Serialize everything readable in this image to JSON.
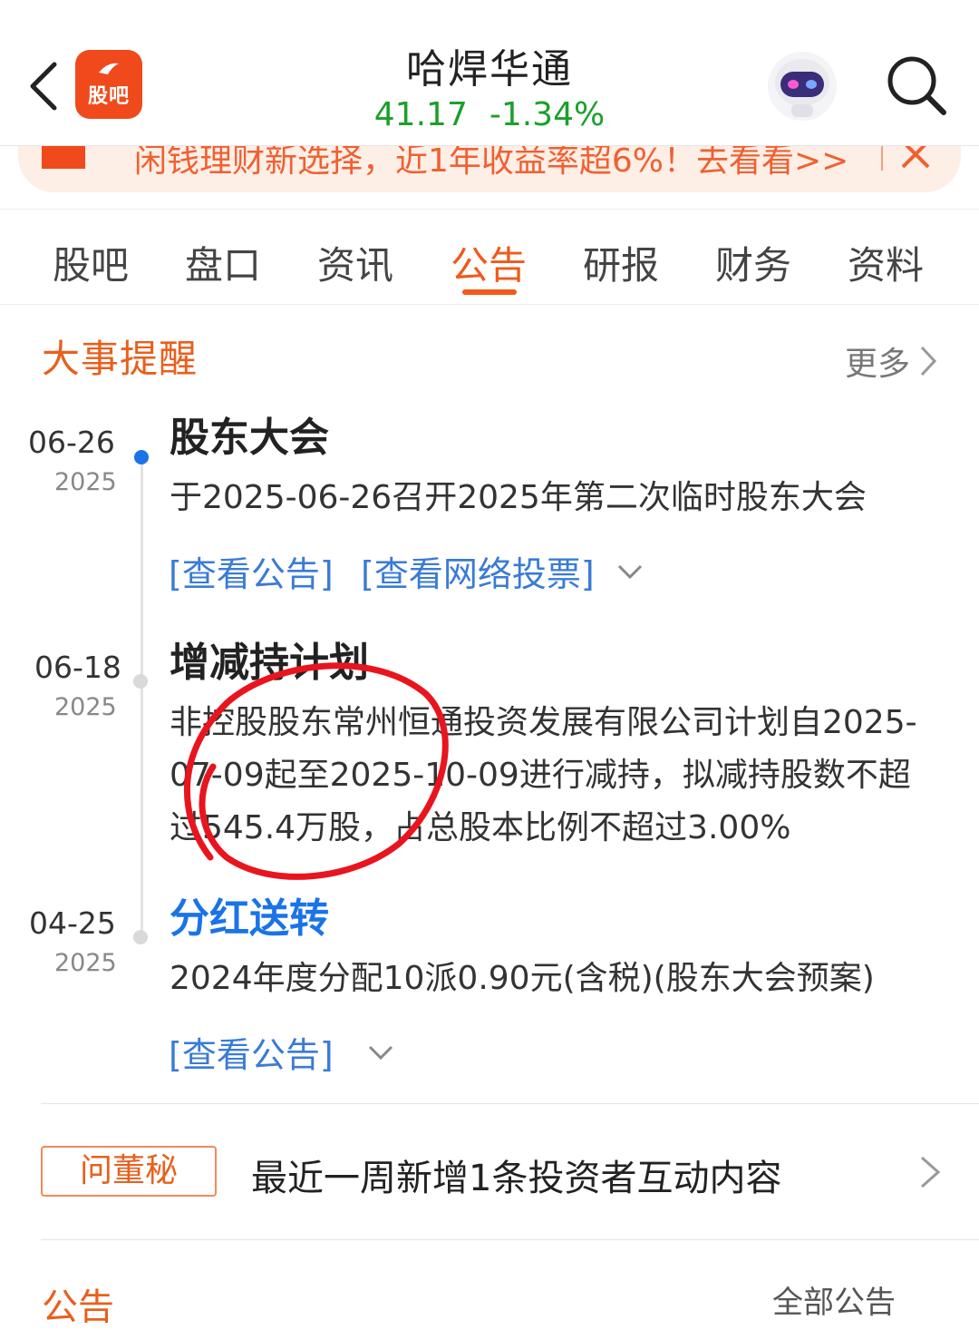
{
  "header": {
    "title": "哈焊华通",
    "price": "41.17",
    "change_pct": "-1.34%",
    "logo_text": "股吧",
    "accent_color": "#f05a1a",
    "up_down_color": "#1aa02a"
  },
  "promo": {
    "text": "闲钱理财新选择，近1年收益率超6%！去看看>>"
  },
  "tabs": [
    {
      "label": "股吧"
    },
    {
      "label": "盘口"
    },
    {
      "label": "资讯"
    },
    {
      "label": "公告",
      "active": true
    },
    {
      "label": "研报"
    },
    {
      "label": "财务"
    },
    {
      "label": "资料"
    }
  ],
  "events_section": {
    "title": "大事提醒",
    "more_label": "更多"
  },
  "events": [
    {
      "date_md": "06-26",
      "date_y": "2025",
      "title": "股东大会",
      "desc": "于2025-06-26召开2025年第二次临时股东大会",
      "links": [
        "[查看公告]",
        "[查看网络投票]"
      ]
    },
    {
      "date_md": "06-18",
      "date_y": "2025",
      "title": "增减持计划",
      "desc": "非控股股东常州恒通投资发展有限公司计划自2025-07-09起至2025-10-09进行减持，拟减持股数不超过545.4万股，占总股本比例不超过3.00%"
    },
    {
      "date_md": "04-25",
      "date_y": "2025",
      "title": "分红送转",
      "desc": "2024年度分配10派0.90元(含税)(股东大会预案)",
      "links": [
        "[查看公告]"
      ]
    }
  ],
  "dongmi": {
    "badge": "问董秘",
    "text": "最近一周新增1条投资者互动内容"
  },
  "announcements": {
    "title": "公告",
    "filter_label": "全部公告"
  }
}
